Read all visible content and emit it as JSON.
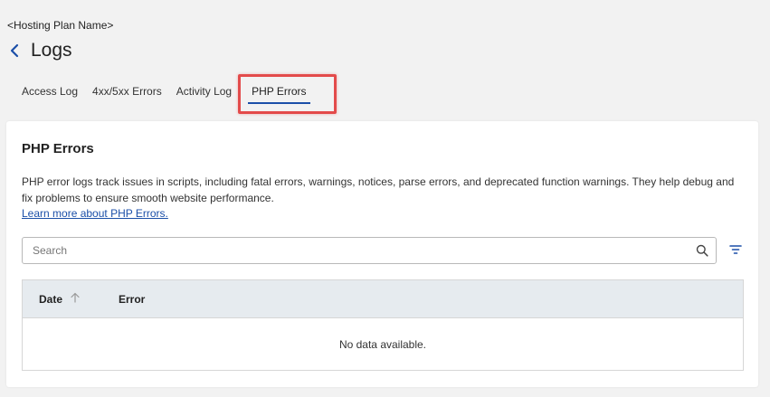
{
  "header": {
    "plan_name": "<Hosting Plan Name>",
    "page_title": "Logs"
  },
  "tabs": [
    {
      "label": "Access Log",
      "active": false
    },
    {
      "label": "4xx/5xx Errors",
      "active": false
    },
    {
      "label": "Activity Log",
      "active": false
    },
    {
      "label": "PHP Errors",
      "active": true
    }
  ],
  "section": {
    "title": "PHP Errors",
    "description": "PHP error logs track issues in scripts, including fatal errors, warnings, notices, parse errors, and deprecated function warnings. They help debug and fix problems to ensure smooth website performance.",
    "learn_more": "Learn more about PHP Errors."
  },
  "search": {
    "placeholder": "Search",
    "value": ""
  },
  "table": {
    "columns": [
      "Date",
      "Error"
    ],
    "sort_column": "Date",
    "sort_direction": "ascending",
    "empty_message": "No data available."
  },
  "colors": {
    "accent": "#1b4fa8",
    "highlight": "#e34b4b",
    "table_header_bg": "#e6ebef"
  },
  "icons": {
    "back": "chevron-left-icon",
    "search": "search-icon",
    "filter": "filter-icon",
    "sort": "arrow-up-icon"
  }
}
